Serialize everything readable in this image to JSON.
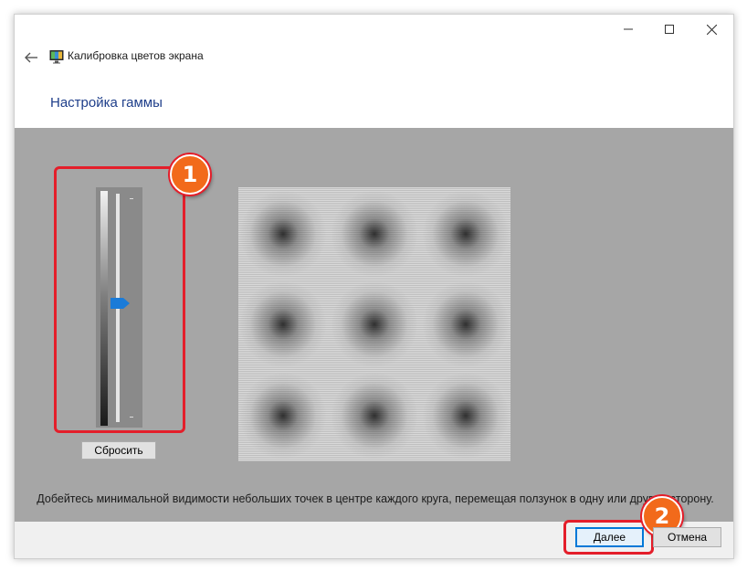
{
  "window": {
    "title": "Калибровка цветов экрана",
    "controls": [
      "minimize-icon",
      "maximize-icon",
      "close-icon"
    ]
  },
  "header": {
    "back_icon": "back-arrow-icon",
    "app_icon": "display-calibration-icon"
  },
  "main": {
    "heading": "Настройка гаммы",
    "slider": {
      "level": 0.54,
      "reset_label": "Сбросить"
    },
    "instruction": "Добейтесь минимальной видимости небольших точек в центре каждого круга, перемещая ползунок в одну или другую сторону."
  },
  "annotations": {
    "badge1": "1",
    "badge2": "2",
    "highlight_color": "#e41e2a",
    "badge_color": "#f26a1b"
  },
  "footer": {
    "next_label": "Далее",
    "cancel_label": "Отмена"
  },
  "colors": {
    "heading": "#1e3e8a",
    "panel_bg": "#a6a6a6",
    "accent": "#0078d7"
  }
}
